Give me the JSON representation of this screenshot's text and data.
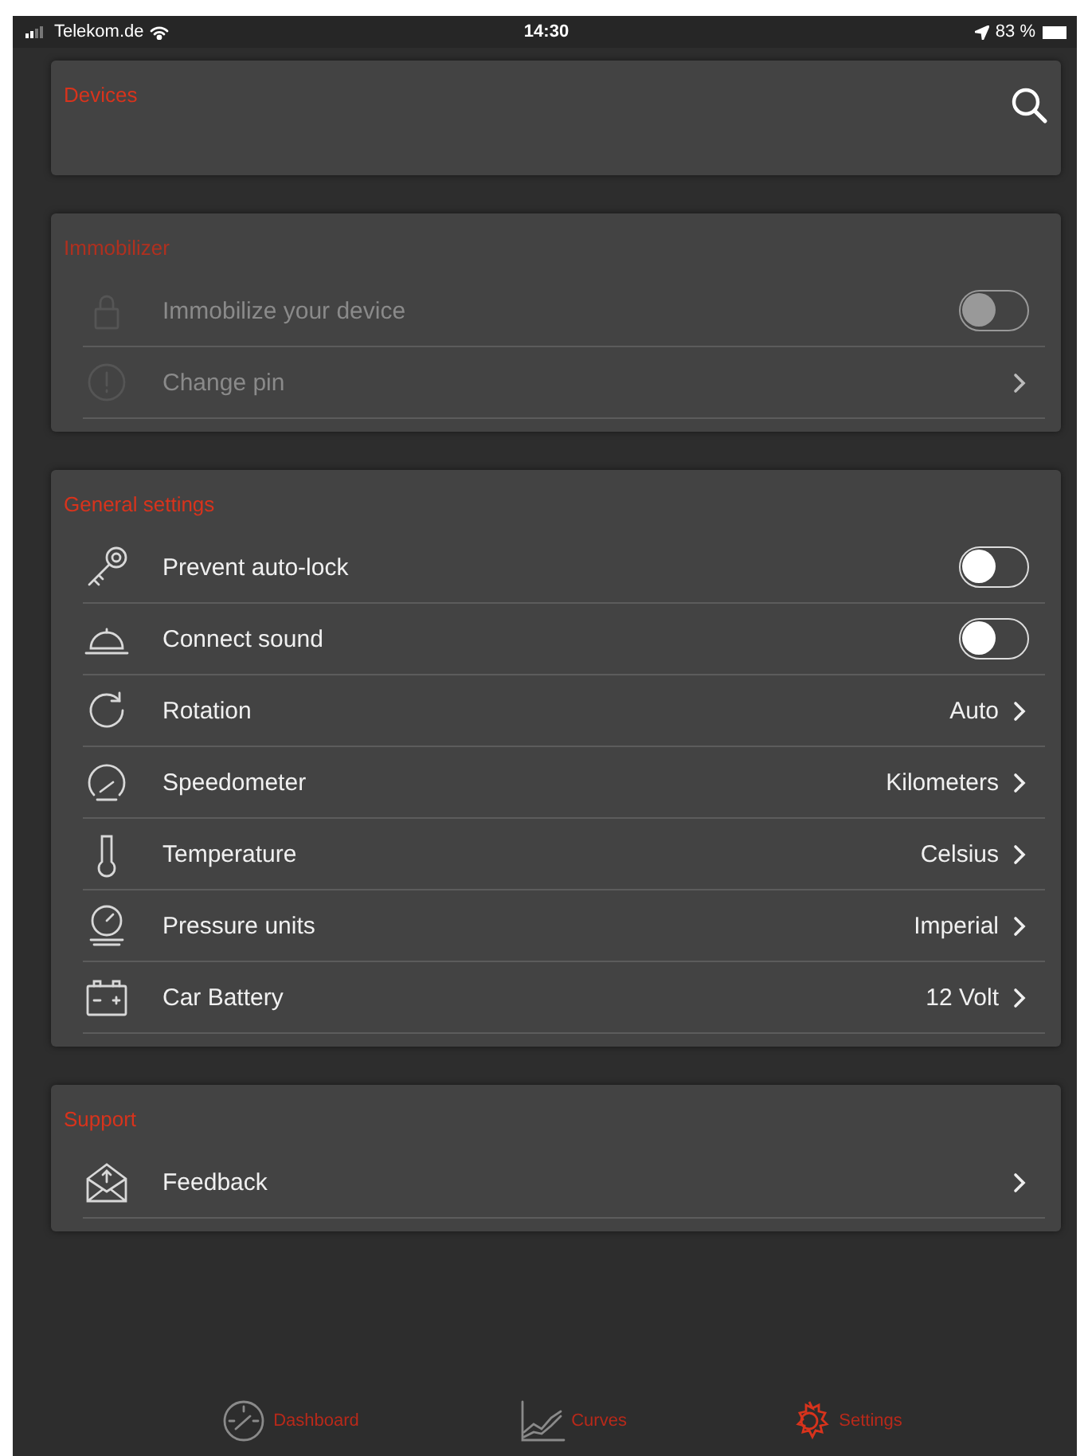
{
  "status_bar": {
    "carrier": "Telekom.de",
    "time": "14:30",
    "battery": "83 %"
  },
  "devices": {
    "title": "Devices"
  },
  "sections": [
    {
      "title": "Immobilizer",
      "disabled": true,
      "rows": [
        {
          "kind": "toggle",
          "label": "Immobilize your device",
          "on": false
        },
        {
          "kind": "link",
          "label": "Change pin"
        }
      ]
    },
    {
      "title": "General settings",
      "disabled": false,
      "rows": [
        {
          "kind": "toggle",
          "label": "Prevent auto-lock",
          "on": false
        },
        {
          "kind": "toggle",
          "label": "Connect sound",
          "on": false
        },
        {
          "kind": "link",
          "label": "Rotation",
          "value": "Auto"
        },
        {
          "kind": "link",
          "label": "Speedometer",
          "value": "Kilometers"
        },
        {
          "kind": "link",
          "label": "Temperature",
          "value": "Celsius"
        },
        {
          "kind": "link",
          "label": "Pressure units",
          "value": "Imperial"
        },
        {
          "kind": "link",
          "label": "Car Battery",
          "value": "12 Volt"
        }
      ]
    },
    {
      "title": "Support",
      "disabled": false,
      "rows": [
        {
          "kind": "link",
          "label": "Feedback"
        }
      ]
    }
  ],
  "tabs": [
    {
      "label": "Dashboard",
      "selected": false
    },
    {
      "label": "Curves",
      "selected": false
    },
    {
      "label": "Settings",
      "selected": true
    }
  ]
}
